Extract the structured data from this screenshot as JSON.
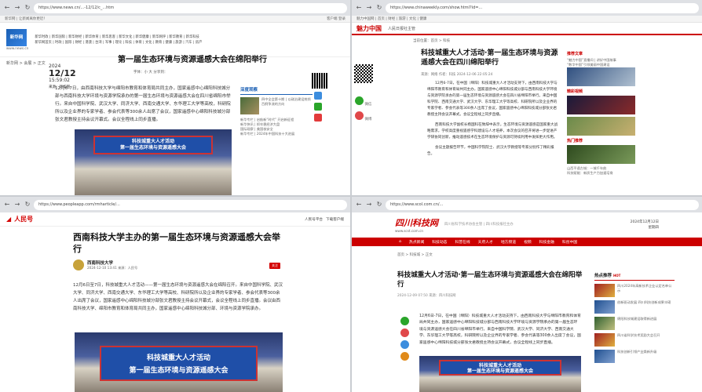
{
  "common": {
    "title_full": "第一届生态环境与资源遥感大会在绵阳举行",
    "photo_banner_1": "科技城重大人才活动",
    "photo_banner_2": "第一届生态环境与资源遥感大会",
    "event_logo": "第一届生态环境与资源遥感大会"
  },
  "q1": {
    "url": "https://www.news.cn/...-12/12/c_...htm",
    "topbar_left": "新华网 | 让新闻离你更近！",
    "topbar_right": "客户端  登录",
    "logo": "新华网",
    "logo_sub": "www.news.cn",
    "channels": "新华时政 | 新华国际 | 新华财经 | 新华体育 | 新华思客 | 新华文化 | 新华健康 | 新华网评 | 新华教育 | 新华科技",
    "channels2": "新华网首页 | 时政 | 国际 | 财经 | 港澳 | 台湾 | 军事 | 理论 | 科技 | 体育 | 文化 | 教育 | 健康 | 旅游 | 汽车 | 房产",
    "crumb": "新华网 > 会展 > 正文",
    "year": "2024",
    "md": "12/12",
    "time": "15:59:02",
    "source": "来源：新华网",
    "title": "第一届生态环境与资源遥感大会在绵阳举行",
    "tools": "字体：小  大    分享到：",
    "body": "12月6-7日，由西南科技大学与绵阳市教育和体育局共同主办，国家遥感中心绵阳科技城分部与西南科技大学环境与资源学院承办的第一届生态环境与资源遥感大会在四川省绵阳市举行。来自中国科学院、武汉大学、同济大学、西南交通大学、东华理工大学等高校，科研院所以及企业界的专家学者、参会代表等300余人出席了会议，国家遥感中心绵阳科技城分部张文君教授主持会议开幕式。会议全程线上同步直播。",
    "side_title": "深度观察",
    "side_items": [
      "四中全会第十期 | 以政治建设统领百舸争流的方向",
      "新华专栏 | 启航新“时代” 开启新征程",
      "新华快讯 | 抓牢稳经济大盘",
      "国际观察 | 美国核安全",
      "新华专栏 | 2024年中国科技十大进展"
    ]
  },
  "q2": {
    "url": "https://www.chinaweekly.com/show.html?id=...",
    "topbar": "魅力中国网 | 首页 | 财经 | 旅游 | 文化 | 健康",
    "logo": "魅力中国",
    "logo_sub": "人民日报社主管",
    "crumb": "当前位置：首页 > 科技",
    "title": "科技城重大人才活动·第一届生态环境与资源遥感大会在四川绵阳举行",
    "meta": "来源：网络  作者：科技  2024-12-06 22:05:24",
    "share_wx": "微信",
    "share_wb": "微博",
    "p1": "12月6-7日，在中国（绵阳）科技城重大人才活动支持下，由西南科技大学与绵阳市教育和体育局共同主办，国家遥感中心绵阳科技城分部与西南科技大学环境与资源学院承办的第一届生态环境与资源遥感大会在四川省绵阳市举行。来自中国科学院、西南交通大学、武汉大学、东华理工大学等高校、科研院所以及企业界的专家学者、参会代表等300余人出席了会议，国家遥感中心绵阳科技城分部张文君教授主持会议开幕式。会议全程线上同步直播。",
    "p2": "西南科技大学副校长杨国科在致辞中表示，生态环境与资源遥感是国家重大战略需求，学校高度重视遥感学科建设与人才培养，本次会议的召开将进一步促进产学研协同创新，推动遥感技术在生态环境保护与资源可持续利用中发挥更大作用。",
    "p3": "会议主题报告环节，中国科学院院士、武汉大学教授等专家分别作了精彩报告。",
    "r1": "推荐文章",
    "r1_items": [
      "“魅力中国”直播间 | 讲好中国故事",
      "“数字中国”引领美丽中国建设"
    ],
    "r2": "精彩视频",
    "r3": "热门推荐",
    "r3_items": [
      "山西平遥古城：一城千年韵",
      "科技赋能：新质生产力加速培育"
    ]
  },
  "q3": {
    "url": "https://www.peopleapp.com/rmharticle/...",
    "logo": "人民号",
    "hdr_right_1": "人民号平台",
    "hdr_right_2": "下载客户端",
    "title": "西南科技大学主办的第一届生态环境与资源遥感大会举行",
    "author": "西南科技大学",
    "author_sub": "2024-12-10 13:41  来源：人民号",
    "follow": "关注",
    "body": "12月6日至7日，科技城重大人才活动——第一届生态环境与资源遥感大会在绵阳召开。来自中国科学院、武汉大学、同济大学、西南交通大学、东华理工大学等高校、科研院所以及企业界的专家学者、参会代表等300余人出席了会议，国家遥感中心绵阳科技城分部张文君教授主持会议开幕式，会议全程线上同步直播。会议由西南科技大学、绵阳市教育和体育局共同主办，国家遥感中心绵阳科技城分部、环境与资源学院承办。"
  },
  "q4": {
    "url": "https://www.scol.com.cn/...",
    "logo": "四川科技网",
    "logo_sub": "www.scst.com.cn",
    "mid": "四川省科学技术协会主管 | 四川科技报社主办",
    "date": "2024年12月12日",
    "weekday": "星期四",
    "nav": [
      "首页",
      "热点新闻",
      "科技动态",
      "科普在线",
      "天府人才",
      "地方频道",
      "视频",
      "科技金融",
      "科创中国",
      "科协风采",
      "专题",
      "图片"
    ],
    "crumb": "首页 > 科技城 > 正文",
    "title": "科技城重大人才活动·第一届生态环境与资源遥感大会在绵阳举行",
    "meta": "2024-12-09 07:50  来源：四川科技网",
    "body": "12月6日-7日，在中国（绵阳）科技城重大人才活动支持下，由西南科技大学与绵阳市教育和体育局共同主办，国家遥感中心绵阳科技城分部与西南科技大学环境与资源学院承办的第一届生态环境与资源遥感大会在四川省绵阳市举行。来自中国科学院、武汉大学、同济大学、西南交通大学、东华理工大学等高校，科研院所以及企业界的专家学者、参会代表等300余人出席了会议，国家遥感中心绵阳科技城分部张文君教授主持会议开幕式，会议全程线上同步直播。",
    "hot": "热点推荐",
    "hot_tag": "HOT",
    "hot_items": [
      "四川2024年高新技术企业认定名单公示",
      "创新驱动发展 四川科技创新成果丰硕",
      "绵阳科技城建设取得新进展",
      "四川省科学技术奖励大会召开",
      "科技创新引领产业焕新升级"
    ]
  }
}
